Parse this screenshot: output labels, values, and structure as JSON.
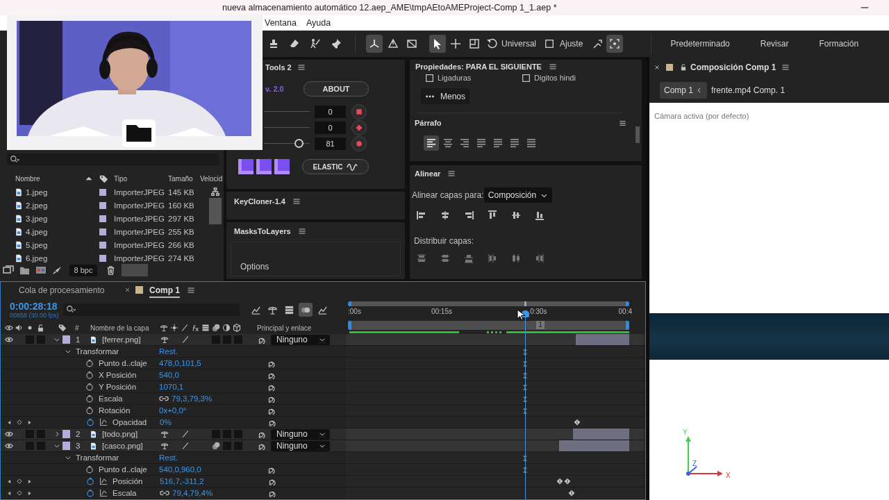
{
  "window": {
    "title": "nueva almacenamiento automático 12.aep_AME\\tmpAEtoAMEProject-Comp 1_1.aep *"
  },
  "menu": [
    "Ventana",
    "Ayuda"
  ],
  "toolbar": {
    "tools": [
      {
        "kind": "stamp",
        "selected": false
      },
      {
        "kind": "eraser",
        "selected": false
      },
      {
        "kind": "puppet",
        "selected": false
      },
      {
        "kind": "pin",
        "selected": false
      },
      {
        "kind": "axis-local",
        "selected": true
      },
      {
        "kind": "axis-world",
        "selected": false
      },
      {
        "kind": "axis-view",
        "selected": false
      },
      {
        "kind": "select",
        "selected": true
      },
      {
        "kind": "move",
        "selected": false
      },
      {
        "kind": "frame",
        "selected": false
      }
    ],
    "axis_mode": "Universal",
    "snapping": {
      "label": "Ajuste",
      "checked": false
    },
    "view_tools": [
      {
        "kind": "snap",
        "selected": false
      },
      {
        "kind": "gizmo",
        "selected": true
      }
    ],
    "workspaces": [
      "Predeterminado",
      "Revisar",
      "Formación"
    ]
  },
  "project": {
    "columns": [
      {
        "label": "Nombre",
        "sorted": true
      },
      {
        "label": "Tipo",
        "sorted": false
      },
      {
        "label": "Tamaño",
        "sorted": false
      },
      {
        "label": "Velocid",
        "sorted": false
      }
    ],
    "items": [
      {
        "name": "1.jpeg",
        "type": "ImporterJPEG",
        "size": "145 KB"
      },
      {
        "name": "2.jpeg",
        "type": "ImporterJPEG",
        "size": "160 KB"
      },
      {
        "name": "3.jpeg",
        "type": "ImporterJPEG",
        "size": "297 KB"
      },
      {
        "name": "4.jpeg",
        "type": "ImporterJPEG",
        "size": "255 KB"
      },
      {
        "name": "5.jpeg",
        "type": "ImporterJPEG",
        "size": "266 KB"
      },
      {
        "name": "6.jpeg",
        "type": "ImporterJPEG",
        "size": "274 KB"
      }
    ],
    "bit_depth": "8 bpc"
  },
  "motion_tools": {
    "title": "Tools 2",
    "version": "v. 2.0",
    "about": "ABOUT",
    "sliders": [
      {
        "value": "0",
        "kind": "square"
      },
      {
        "value": "0",
        "kind": "diamond"
      },
      {
        "value": "81",
        "kind": "circle",
        "level": 0.75
      }
    ],
    "ease": "ELASTIC"
  },
  "keycloner": {
    "title": "KeyCloner-1.4"
  },
  "masks_to_layers": {
    "title": "MasksToLayers",
    "options": "Options"
  },
  "properties": {
    "title": "Propiedades: PARA EL SIGUIENTE",
    "options": [
      {
        "label": "Ligaduras",
        "checked": false
      },
      {
        "label": "Digitos hindi",
        "checked": false
      }
    ],
    "less": "Menos",
    "paragraph": {
      "title": "Párrafo",
      "alignments": [
        {
          "selected": true
        },
        {
          "selected": false
        },
        {
          "selected": false
        },
        {
          "selected": false
        },
        {
          "selected": false
        },
        {
          "selected": false
        },
        {
          "selected": false
        }
      ]
    }
  },
  "align": {
    "title": "Alinear",
    "align_to_label": "Alinear capas para:",
    "align_to": "Composición",
    "distribute_label": "Distribuir capas:"
  },
  "composition": {
    "title": "Composición Comp 1",
    "breadcrumbs": [
      {
        "label": "Comp 1",
        "selected": true
      },
      {
        "label": "frente.mp4 Comp. 1",
        "selected": false
      }
    ],
    "camera": "Cámara activa (por defecto)",
    "axes": [
      "Y",
      "Z",
      "X"
    ]
  },
  "timeline": {
    "tabs": [
      {
        "label": "Cola de procesamiento",
        "selected": false
      },
      {
        "label": "Comp 1",
        "selected": true
      }
    ],
    "timecode": "0:00:28:18",
    "frame_info": "00858 (30.00 fps)",
    "columns": [
      "#",
      "Nombre de la capa",
      "Principal y enlace"
    ],
    "ruler": [
      ":00s",
      "00:15s",
      "0:30s",
      "00:4"
    ],
    "playhead": {
      "level": 0.63
    },
    "marker": {
      "label": "1",
      "level": 0.67
    },
    "rows": [
      {
        "kind": "layer",
        "number": "1",
        "name": "[ferrer.png]",
        "expanded": true,
        "visible": true,
        "motion_blur": false,
        "parent": "Ninguno",
        "level": 0.81
      },
      {
        "kind": "group",
        "name": "Transformar",
        "value": "Rest.",
        "expanded": true
      },
      {
        "kind": "prop",
        "name": "Punto d..claje",
        "value": "478,0,101,5",
        "linked": false,
        "animated": false
      },
      {
        "kind": "prop",
        "name": "X Posición",
        "value": "540,0",
        "linked": false,
        "animated": false
      },
      {
        "kind": "prop",
        "name": "Y Posición",
        "value": "1070,1",
        "linked": false,
        "animated": false
      },
      {
        "kind": "prop",
        "name": "Escala",
        "value": "79,3,79,3%",
        "linked": true,
        "animated": false
      },
      {
        "kind": "prop",
        "name": "Rotación",
        "value": "0x+0,0°",
        "linked": false,
        "animated": false
      },
      {
        "kind": "prop",
        "name": "Opacidad",
        "value": "0%",
        "linked": false,
        "animated": true,
        "keys": [
          {
            "level": 0.815
          }
        ]
      },
      {
        "kind": "layer",
        "number": "2",
        "name": "[todo.png]",
        "expanded": false,
        "visible": true,
        "motion_blur": false,
        "parent": "Ninguno",
        "level": 0.8
      },
      {
        "kind": "layer",
        "number": "3",
        "name": "[casco.png]",
        "expanded": true,
        "visible": true,
        "motion_blur": true,
        "parent": "Ninguno",
        "level": 0.75
      },
      {
        "kind": "group",
        "name": "Transformar",
        "value": "Rest.",
        "expanded": true
      },
      {
        "kind": "prop",
        "name": "Punto d..claje",
        "value": "540,0,960,0",
        "linked": false,
        "animated": false
      },
      {
        "kind": "prop",
        "name": "Posición",
        "value": "516,7,-311,2",
        "linked": false,
        "animated": true,
        "keys": [
          {
            "level": 0.753
          },
          {
            "level": 0.78
          }
        ]
      },
      {
        "kind": "prop",
        "name": "Escala",
        "value": "79,4,79,4%",
        "linked": true,
        "animated": true,
        "keys": [
          {
            "level": 0.795
          }
        ]
      }
    ]
  }
}
